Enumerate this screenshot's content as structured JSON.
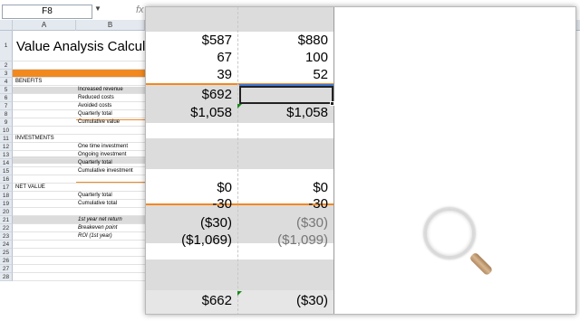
{
  "formula_bar": {
    "name_box": "F8",
    "fx_symbol": "fx"
  },
  "columns": [
    "A",
    "B"
  ],
  "sheet": {
    "title": "Value Analysis Calculat",
    "rows": [
      {
        "num": "1",
        "label": "",
        "indent": false
      },
      {
        "num": "2",
        "label": "",
        "indent": false
      },
      {
        "num": "3",
        "label": "",
        "indent": false
      },
      {
        "num": "4",
        "label": "BENEFITS",
        "indent": false
      },
      {
        "num": "5",
        "label": "Increased revenue",
        "indent": true
      },
      {
        "num": "6",
        "label": "Reduced costs",
        "indent": true
      },
      {
        "num": "7",
        "label": "Avoided costs",
        "indent": true
      },
      {
        "num": "8",
        "label": "Quarterly total",
        "indent": true
      },
      {
        "num": "9",
        "label": "Cumulative value",
        "indent": true
      },
      {
        "num": "10",
        "label": "",
        "indent": false
      },
      {
        "num": "11",
        "label": "INVESTMENTS",
        "indent": false
      },
      {
        "num": "12",
        "label": "One time investment",
        "indent": true
      },
      {
        "num": "13",
        "label": "Ongoing investment",
        "indent": true
      },
      {
        "num": "14",
        "label": "Quarterly total",
        "indent": true
      },
      {
        "num": "15",
        "label": "Cumulative investment",
        "indent": true
      },
      {
        "num": "16",
        "label": "",
        "indent": false
      },
      {
        "num": "17",
        "label": "NET VALUE",
        "indent": false
      },
      {
        "num": "18",
        "label": "Quarterly total",
        "indent": true
      },
      {
        "num": "19",
        "label": "Cumulative total",
        "indent": true
      },
      {
        "num": "20",
        "label": "",
        "indent": false
      },
      {
        "num": "21",
        "label": "1st year net return",
        "indent": true
      },
      {
        "num": "22",
        "label": "Breakeven point",
        "indent": true
      },
      {
        "num": "23",
        "label": "ROI (1st year)",
        "indent": true
      },
      {
        "num": "24",
        "label": "",
        "indent": false
      },
      {
        "num": "25",
        "label": "",
        "indent": false
      },
      {
        "num": "26",
        "label": "",
        "indent": false
      },
      {
        "num": "27",
        "label": "",
        "indent": false
      },
      {
        "num": "28",
        "label": "",
        "indent": false
      }
    ]
  },
  "zoom": {
    "col1": [
      "$587",
      "67",
      "39",
      "$692",
      "$1,058",
      "$0",
      "-30",
      "($30)",
      "($1,069)",
      "$662"
    ],
    "col2": [
      "$880",
      "100",
      "52",
      "",
      "$1,058",
      "$0",
      "-30",
      "($30)",
      "($1,099)",
      "($30)"
    ]
  },
  "colors": {
    "accent_orange": "#f2891f",
    "band_gray": "#dcdcdc",
    "selection_blue": "#3c78d8"
  }
}
